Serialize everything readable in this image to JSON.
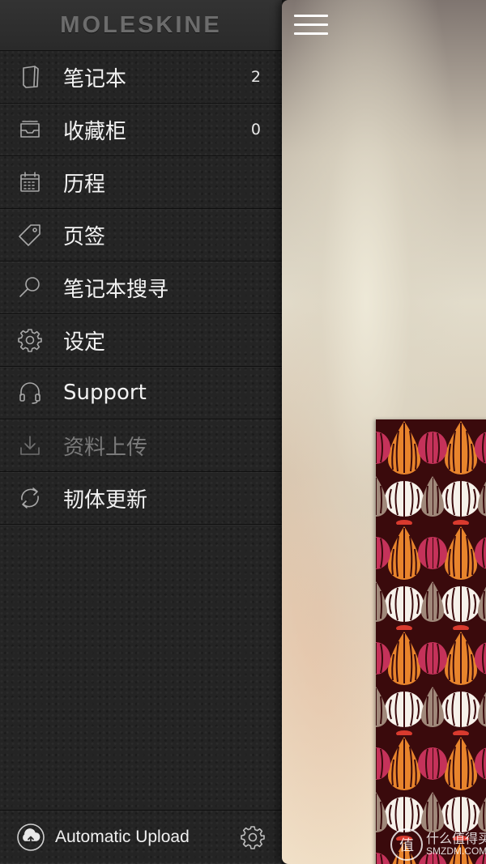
{
  "brand": {
    "name": "MOLESKINE"
  },
  "menu": {
    "items": [
      {
        "label": "笔记本",
        "count": "2",
        "icon": "notebook-icon"
      },
      {
        "label": "收藏柜",
        "count": "0",
        "icon": "tray-icon"
      },
      {
        "label": "历程",
        "count": "",
        "icon": "calendar-icon"
      },
      {
        "label": "页签",
        "count": "",
        "icon": "tag-icon"
      },
      {
        "label": "笔记本搜寻",
        "count": "",
        "icon": "search-icon"
      },
      {
        "label": "设定",
        "count": "",
        "icon": "gear-icon"
      },
      {
        "label": "Support",
        "count": "",
        "icon": "headset-icon"
      },
      {
        "label": "资料上传",
        "count": "",
        "icon": "download-icon",
        "disabled": true
      },
      {
        "label": "韧体更新",
        "count": "",
        "icon": "refresh-icon"
      }
    ]
  },
  "footer": {
    "label": "Automatic Upload",
    "icon": "cloud-upload-icon",
    "settings_icon": "gear-icon"
  },
  "content": {
    "menu_icon": "hamburger-icon"
  },
  "watermark": {
    "badge": "值",
    "title": "什么值得买",
    "subtitle": "SMZDM.COM"
  },
  "colors": {
    "drawer_bg": "#242424",
    "text": "#f2f2f2",
    "text_disabled": "#7a7a7a",
    "cover_bg": "#3a0a0c"
  }
}
